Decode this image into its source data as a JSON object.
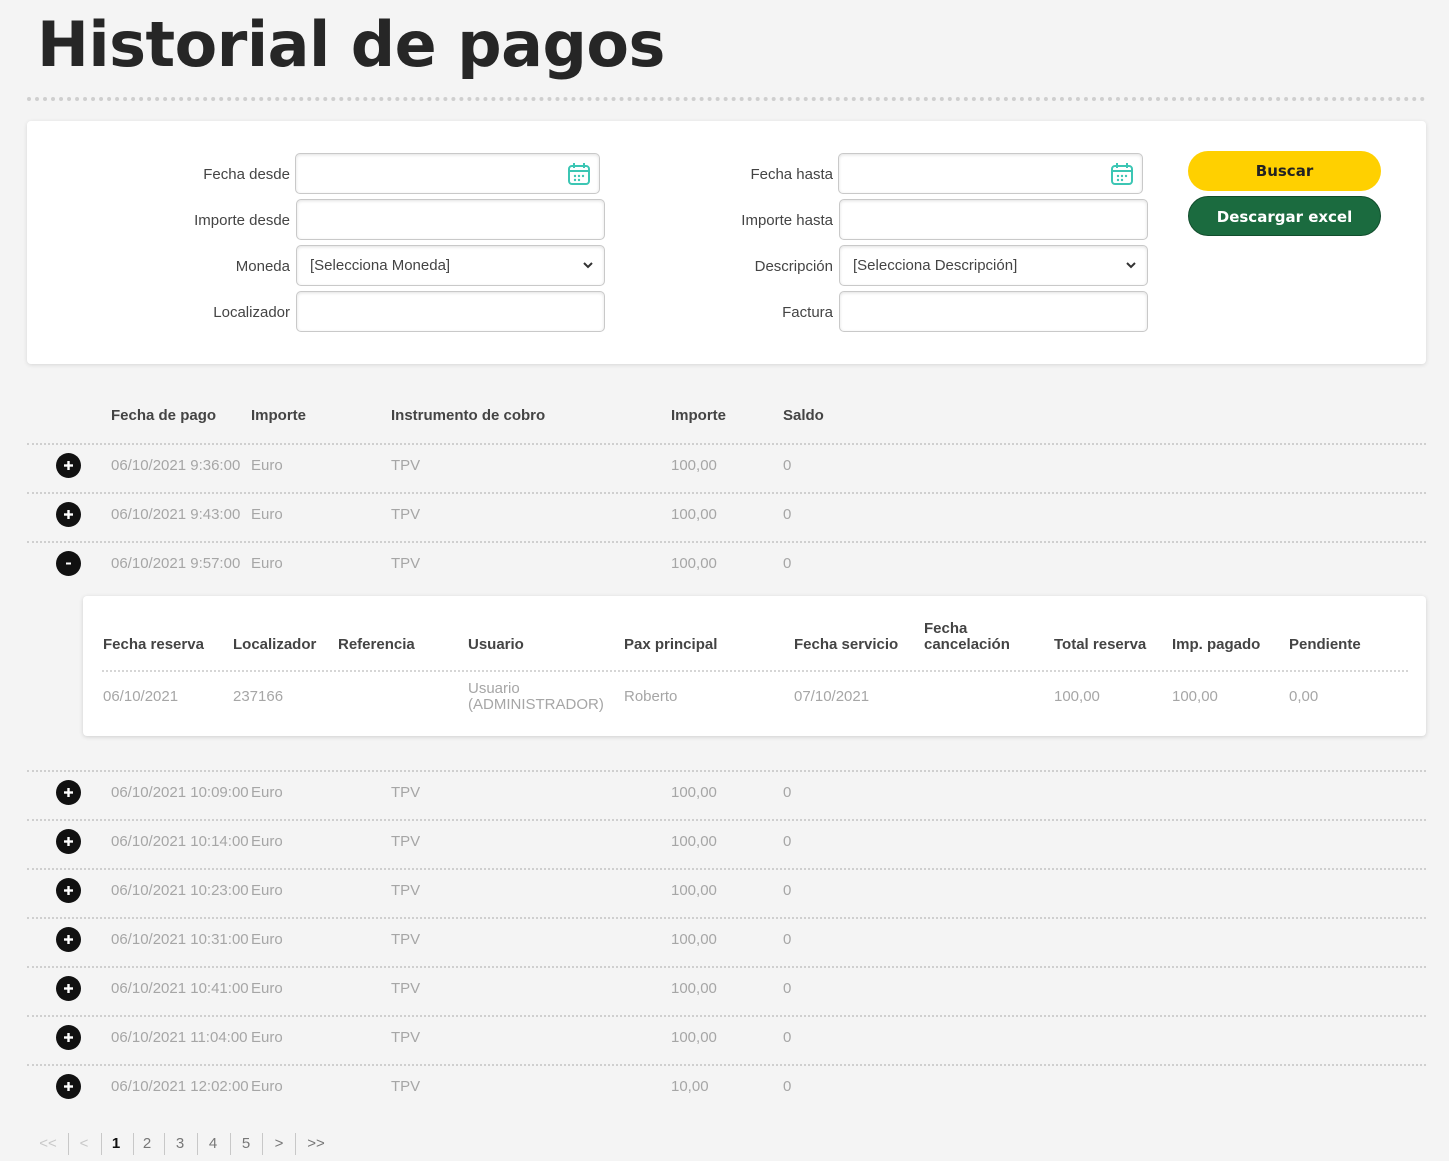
{
  "page": {
    "title": "Historial de pagos"
  },
  "filters": {
    "fecha_desde": {
      "label": "Fecha desde",
      "value": ""
    },
    "fecha_hasta": {
      "label": "Fecha hasta",
      "value": ""
    },
    "importe_desde": {
      "label": "Importe desde",
      "value": ""
    },
    "importe_hasta": {
      "label": "Importe hasta",
      "value": ""
    },
    "moneda": {
      "label": "Moneda",
      "selected": "[Selecciona Moneda]"
    },
    "descripcion": {
      "label": "Descripción",
      "selected": "[Selecciona Descripción]"
    },
    "localizador": {
      "label": "Localizador",
      "value": ""
    },
    "factura": {
      "label": "Factura",
      "value": ""
    }
  },
  "actions": {
    "buscar": "Buscar",
    "excel": "Descargar excel"
  },
  "table": {
    "headers": [
      "Fecha de pago",
      "Importe",
      "Instrumento de cobro",
      "Importe",
      "Saldo"
    ],
    "rows": [
      {
        "fecha": "06/10/2021 9:36:00",
        "moneda": "Euro",
        "instrumento": "TPV",
        "importe": "100,00",
        "saldo": "0",
        "expanded": false
      },
      {
        "fecha": "06/10/2021 9:43:00",
        "moneda": "Euro",
        "instrumento": "TPV",
        "importe": "100,00",
        "saldo": "0",
        "expanded": false
      },
      {
        "fecha": "06/10/2021 9:57:00",
        "moneda": "Euro",
        "instrumento": "TPV",
        "importe": "100,00",
        "saldo": "0",
        "expanded": true
      },
      {
        "fecha": "06/10/2021 10:09:00",
        "moneda": "Euro",
        "instrumento": "TPV",
        "importe": "100,00",
        "saldo": "0",
        "expanded": false
      },
      {
        "fecha": "06/10/2021 10:14:00",
        "moneda": "Euro",
        "instrumento": "TPV",
        "importe": "100,00",
        "saldo": "0",
        "expanded": false
      },
      {
        "fecha": "06/10/2021 10:23:00",
        "moneda": "Euro",
        "instrumento": "TPV",
        "importe": "100,00",
        "saldo": "0",
        "expanded": false
      },
      {
        "fecha": "06/10/2021 10:31:00",
        "moneda": "Euro",
        "instrumento": "TPV",
        "importe": "100,00",
        "saldo": "0",
        "expanded": false
      },
      {
        "fecha": "06/10/2021 10:41:00",
        "moneda": "Euro",
        "instrumento": "TPV",
        "importe": "100,00",
        "saldo": "0",
        "expanded": false
      },
      {
        "fecha": "06/10/2021 11:04:00",
        "moneda": "Euro",
        "instrumento": "TPV",
        "importe": "100,00",
        "saldo": "0",
        "expanded": false
      },
      {
        "fecha": "06/10/2021 12:02:00",
        "moneda": "Euro",
        "instrumento": "TPV",
        "importe": "10,00",
        "saldo": "0",
        "expanded": false
      }
    ]
  },
  "detail": {
    "headers": {
      "fecha_reserva": "Fecha reserva",
      "localizador": "Localizador",
      "referencia": "Referencia",
      "usuario": "Usuario",
      "pax_principal": "Pax principal",
      "fecha_servicio": "Fecha servicio",
      "fecha_cancelacion_1": "Fecha",
      "fecha_cancelacion_2": "cancelación",
      "total_reserva": "Total reserva",
      "imp_pagado": "Imp. pagado",
      "pendiente": "Pendiente"
    },
    "row": {
      "fecha_reserva": "06/10/2021",
      "localizador": "237166",
      "referencia": "",
      "usuario_1": "Usuario",
      "usuario_2": "(ADMINISTRADOR)",
      "pax_principal": "Roberto",
      "fecha_servicio": "07/10/2021",
      "fecha_cancelacion": "",
      "total_reserva": "100,00",
      "imp_pagado": "100,00",
      "pendiente": "0,00"
    }
  },
  "pagination": {
    "first": "<<",
    "prev": "<",
    "pages": [
      "1",
      "2",
      "3",
      "4",
      "5"
    ],
    "current": "1",
    "next": ">",
    "last": ">>"
  },
  "colors": {
    "accent_yellow": "#ffd000",
    "accent_green": "#1b6b3f",
    "calendar_teal": "#3cc6b4"
  }
}
